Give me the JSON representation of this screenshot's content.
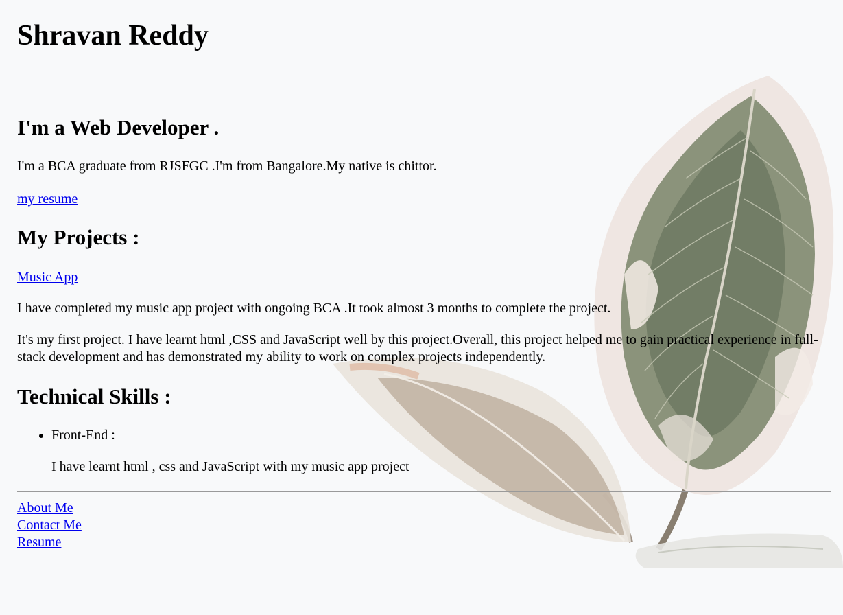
{
  "header": {
    "name": "Shravan Reddy"
  },
  "intro": {
    "heading": "I'm a Web Developer .",
    "bio": "I'm a BCA graduate from RJSFGC .I'm from Bangalore.My native is chittor.",
    "resume_link": "my resume"
  },
  "projects": {
    "heading": "My Projects :",
    "project_link": "Music App",
    "paragraph_1": "I have completed my music app project with ongoing BCA .It took almost 3 months to complete the project.",
    "paragraph_2": "It's my first project. I have learnt html ,CSS and JavaScript well by this project.Overall, this project helped me to gain practical experience in full-stack development and has demonstrated my ability to work on complex projects independently."
  },
  "skills": {
    "heading": "Technical Skills :",
    "items": [
      {
        "label": "Front-End :",
        "detail": "I have learnt html , css and JavaScript with my music app project"
      }
    ]
  },
  "footer": {
    "links": [
      "About Me",
      "Contact Me",
      "Resume"
    ]
  },
  "colors": {
    "background": "#f8f9fa",
    "link": "#0000ee",
    "rule": "#9a9a9a"
  },
  "icons": {
    "background_image": "leaf-plant-image"
  }
}
